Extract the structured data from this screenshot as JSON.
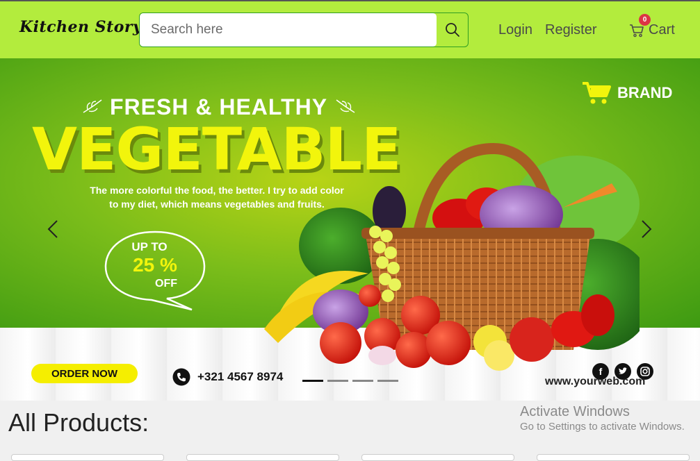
{
  "navbar": {
    "brand": "Kitchen Story",
    "search_placeholder": "Search here",
    "search_icon": "search-icon",
    "login": "Login",
    "register": "Register",
    "cart_label": "Cart",
    "cart_count": "0",
    "bg_color": "#b3ec3d"
  },
  "banner": {
    "headline_top": "FRESH & HEALTHY",
    "headline_main": "VEGETABLE",
    "tagline_line1": "The more colorful the food, the better. I try to add color",
    "tagline_line2": "to my diet, which means vegetables and fruits.",
    "offer_line1": "UP TO",
    "offer_line2": "25 %",
    "offer_line3": "OFF",
    "brand_text": "BRAND",
    "order_button": "ORDER NOW",
    "phone": "+321 4567 8974",
    "website": "www.yourweb.com",
    "socials": [
      "facebook-icon",
      "twitter-icon",
      "instagram-icon"
    ],
    "slides_total": 4,
    "active_slide": 1
  },
  "main": {
    "heading": "All Products:"
  },
  "watermark": {
    "title": "Activate Windows",
    "subtitle": "Go to Settings to activate Windows."
  }
}
